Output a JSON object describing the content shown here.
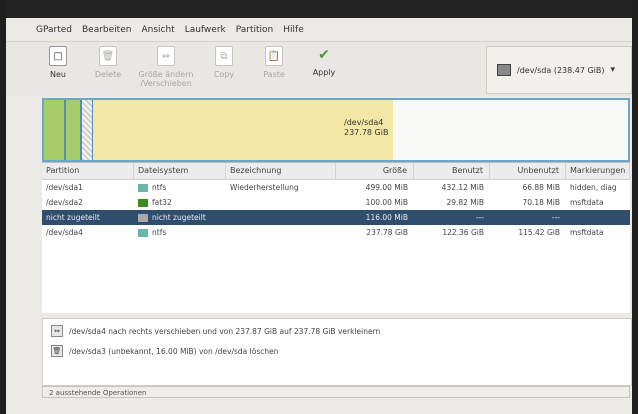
{
  "menu": [
    "GParted",
    "Bearbeiten",
    "Ansicht",
    "Laufwerk",
    "Partition",
    "Hilfe"
  ],
  "toolbar": [
    {
      "label": "Neu",
      "icon": "new-doc-icon",
      "enabled": true
    },
    {
      "label": "Delete",
      "icon": "trash-icon",
      "enabled": false
    },
    {
      "label": "Größe ändern /Verschieben",
      "icon": "resize-icon",
      "enabled": false
    },
    {
      "label": "Copy",
      "icon": "copy-icon",
      "enabled": false
    },
    {
      "label": "Paste",
      "icon": "paste-icon",
      "enabled": false
    },
    {
      "label": "Apply",
      "icon": "check-icon",
      "enabled": true
    }
  ],
  "device": {
    "label": "/dev/sda  (238.47 GiB)"
  },
  "diskmap": {
    "label_line1": "/dev/sda4",
    "label_line2": "237.78 GiB"
  },
  "columns": [
    "Partition",
    "Dateisystem",
    "Bezeichnung",
    "Größe",
    "Benutzt",
    "Unbenutzt",
    "Markierungen"
  ],
  "rows": [
    {
      "partition": "/dev/sda1",
      "fs": "ntfs",
      "fs_color": "#6ab7a8",
      "label": "Wiederherstellung",
      "size": "499.00 MiB",
      "used": "432.12 MiB",
      "unused": "66.88 MiB",
      "flags": "hidden, diag",
      "selected": false
    },
    {
      "partition": "/dev/sda2",
      "fs": "fat32",
      "fs_color": "#3e8b22",
      "label": "",
      "size": "100.00 MiB",
      "used": "29.82 MiB",
      "unused": "70.18 MiB",
      "flags": "msftdata",
      "selected": false
    },
    {
      "partition": "nicht zugeteilt",
      "fs": "nicht zugeteilt",
      "fs_color": "#a9a9a9",
      "label": "",
      "size": "116.00 MiB",
      "used": "---",
      "unused": "---",
      "flags": "",
      "selected": true
    },
    {
      "partition": "/dev/sda4",
      "fs": "ntfs",
      "fs_color": "#6ab7a8",
      "label": "",
      "size": "237.78 GiB",
      "used": "122.36 GiB",
      "unused": "115.42 GiB",
      "flags": "msftdata",
      "selected": false
    }
  ],
  "operations": [
    {
      "icon": "resize-icon",
      "text": "/dev/sda4 nach rechts verschieben und von 237.87 GiB auf 237.78 GiB verkleinern"
    },
    {
      "icon": "trash-icon",
      "text": "/dev/sda3 (unbekannt, 16.00 MiB) von /dev/sda löschen"
    }
  ],
  "status": "2 ausstehende Operationen"
}
